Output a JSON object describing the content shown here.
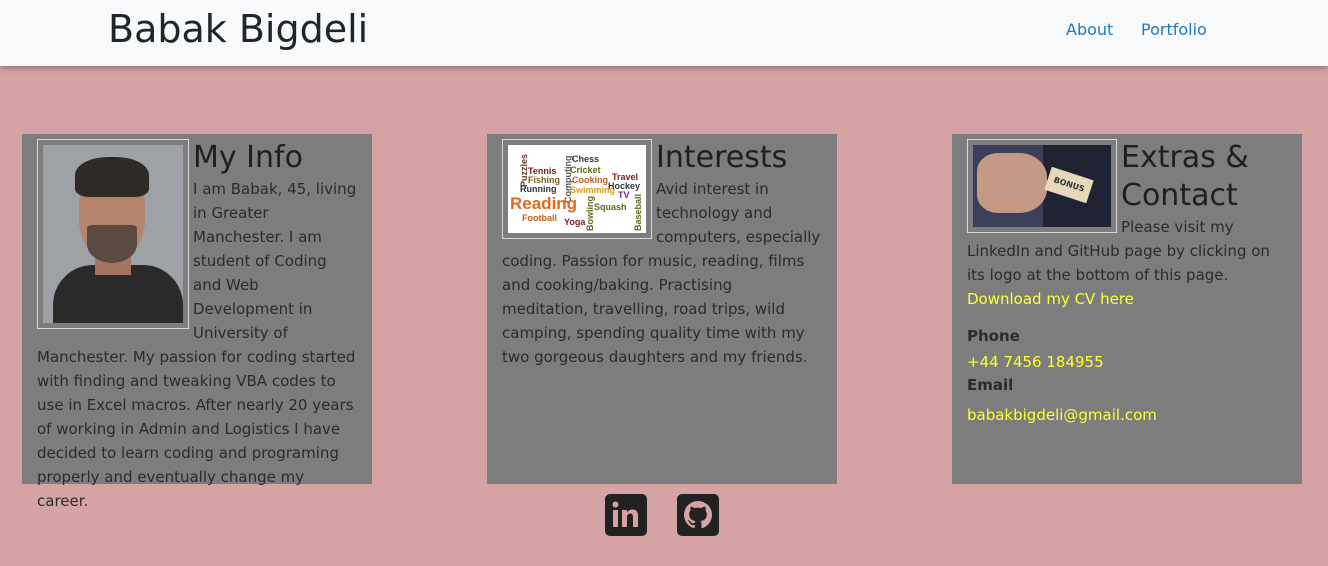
{
  "nav": {
    "brand": "Babak Bigdeli",
    "links": [
      "About",
      "Portfolio"
    ]
  },
  "cards": {
    "info": {
      "title": "My Info",
      "body": "I am Babak, 45, living in Greater Manchester. I am student of Coding and Web Development in University of Manchester. My passion for coding started with finding and tweaking VBA codes to use in Excel macros. After nearly 20 years of working in Admin and Logistics I have decided to learn coding and programing properly and eventually change my career."
    },
    "interests": {
      "title": "Interests",
      "body": "Avid interest in technology and computers, especially coding. Passion for music, reading, films and cooking/baking. Practising meditation, travelling, road trips, wild camping, spending quality time with my two gorgeous daughters and my friends.",
      "cloud_words": [
        "Puzzles",
        "Tennis",
        "Fishing",
        "Running",
        "Computing",
        "Chess",
        "Cricket",
        "Cooking",
        "Swimming",
        "Travel",
        "Hockey",
        "TV",
        "Reading",
        "Football",
        "Yoga",
        "Bowling",
        "Squash",
        "Baseball"
      ]
    },
    "extras": {
      "title": "Extras & Contact",
      "body": "Please visit my LinkedIn and GitHub page by clicking on its logo at the bottom of this page.",
      "cv_link": "Download my CV here",
      "phone_label": "Phone",
      "phone": "+44 7456 184955",
      "email_label": "Email",
      "email": "babakbigdeli@gmail.com",
      "image_tag": "BONUS"
    }
  },
  "social": {
    "linkedin_icon": "linkedin-icon",
    "github_icon": "github-icon"
  },
  "colors": {
    "page_bg": "#d5a3a3",
    "card_bg": "#7d7d7d",
    "link_yellow": "#ffff33",
    "nav_link": "#1f7abf"
  }
}
